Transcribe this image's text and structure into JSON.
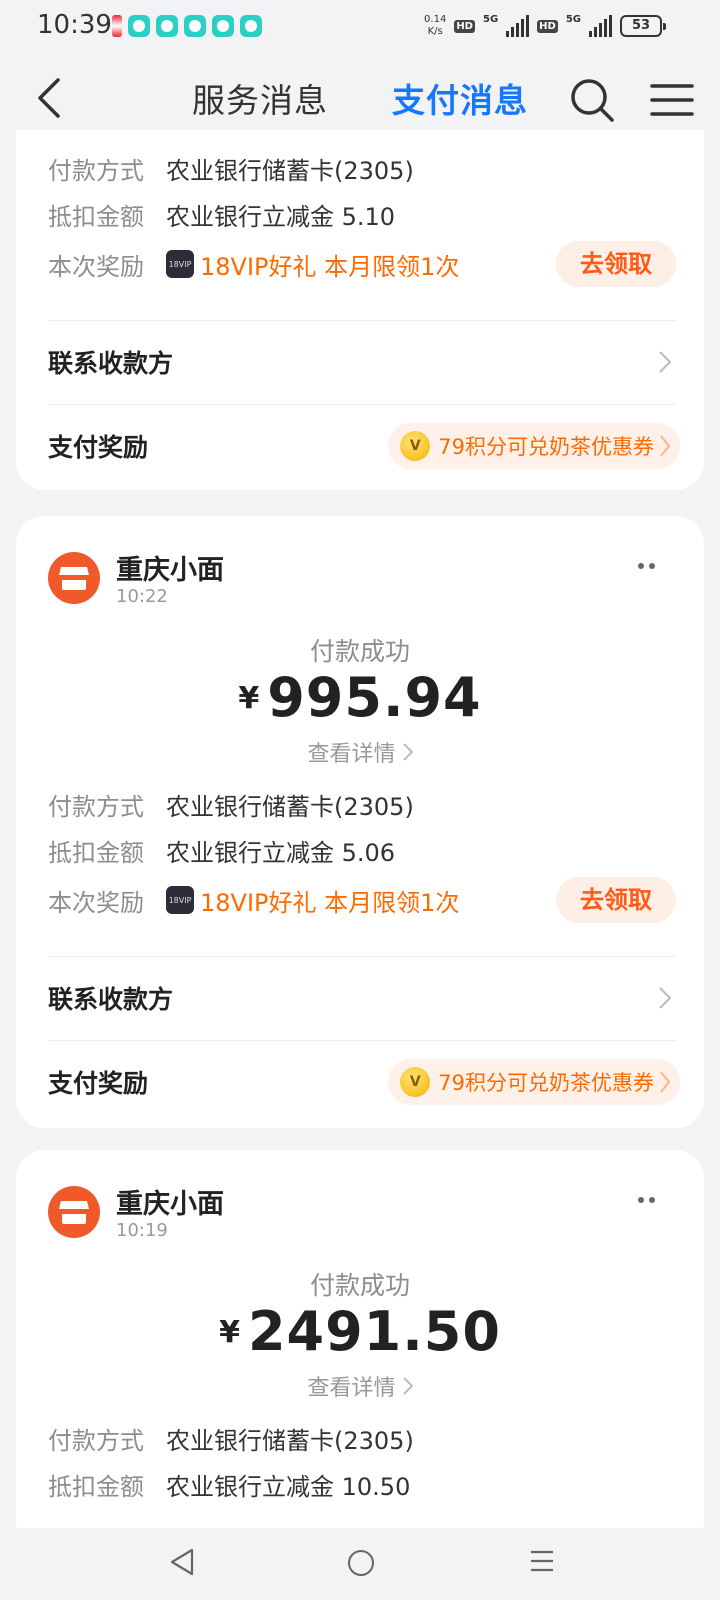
{
  "status_bar": {
    "time": "10:39",
    "net_speed_value": "0.14",
    "net_speed_unit": "K/s",
    "hd": "HD",
    "network": "5G",
    "battery": "53"
  },
  "header": {
    "tab_service": "服务消息",
    "tab_payment": "支付消息"
  },
  "cards": [
    {
      "payment_method_label": "付款方式",
      "payment_method_value": "农业银行储蓄卡(2305)",
      "discount_label": "抵扣金额",
      "discount_value": "农业银行立减金 5.10",
      "reward_label": "本次奖励",
      "vip_badge": "18VIP",
      "reward_value": "18VIP好礼 本月限领1次",
      "claim_label": "去领取",
      "contact_label": "联系收款方",
      "pay_reward_label": "支付奖励",
      "pay_reward_value": "79积分可兑奶茶优惠券"
    },
    {
      "merchant": "重庆小面",
      "time": "10:22",
      "status": "付款成功",
      "currency": "¥",
      "amount": "995.94",
      "detail_link": "查看详情",
      "payment_method_label": "付款方式",
      "payment_method_value": "农业银行储蓄卡(2305)",
      "discount_label": "抵扣金额",
      "discount_value": "农业银行立减金 5.06",
      "reward_label": "本次奖励",
      "vip_badge": "18VIP",
      "reward_value": "18VIP好礼 本月限领1次",
      "claim_label": "去领取",
      "contact_label": "联系收款方",
      "pay_reward_label": "支付奖励",
      "pay_reward_value": "79积分可兑奶茶优惠券"
    },
    {
      "merchant": "重庆小面",
      "time": "10:19",
      "status": "付款成功",
      "currency": "¥",
      "amount": "2491.50",
      "detail_link": "查看详情",
      "payment_method_label": "付款方式",
      "payment_method_value": "农业银行储蓄卡(2305)",
      "discount_label": "抵扣金额",
      "discount_value": "农业银行立减金 10.50"
    }
  ],
  "colors": {
    "accent": "#1677ff",
    "reward_orange": "#ff6a00",
    "merchant_logo": "#f0592a"
  }
}
